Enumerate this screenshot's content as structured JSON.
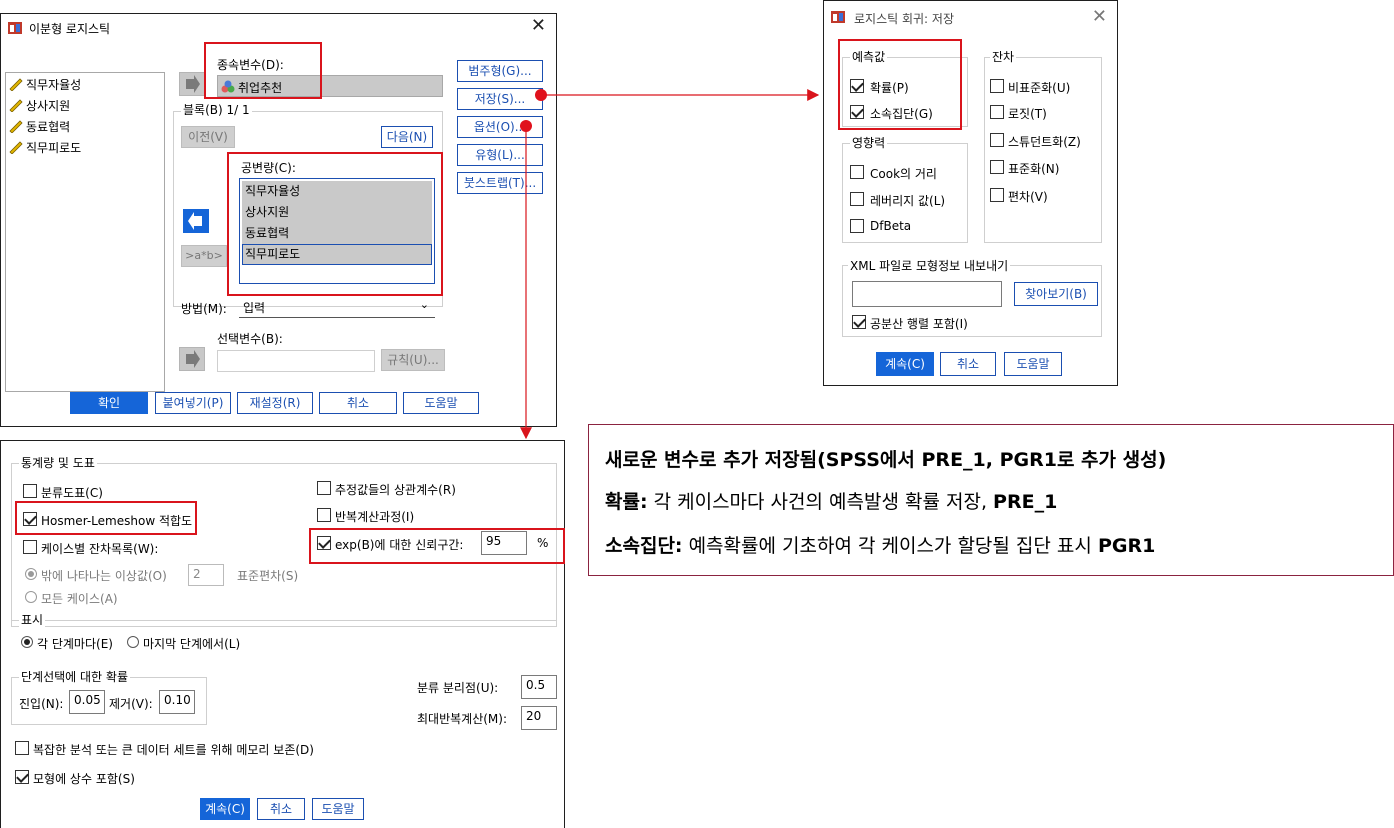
{
  "binary_dialog": {
    "title": "이분형 로지스틱",
    "variables": [
      "직무자율성",
      "상사지원",
      "동료협력",
      "직무피로도"
    ],
    "dependent_label": "종속변수(D):",
    "dependent_value": "취업추천",
    "block_label": "블록(B) 1/ 1",
    "prev_label": "이전(V)",
    "next_label": "다음(N)",
    "covariates_label": "공변량(C):",
    "covariates": [
      "직무자율성",
      "상사지원",
      "동료협력",
      "직무피로도"
    ],
    "interaction_label": ">a*b>",
    "method_label": "방법(M):",
    "method_value": "입력",
    "selection_label": "선택변수(B):",
    "rule_label": "규칙(U)...",
    "side_buttons": [
      "범주형(G)...",
      "저장(S)...",
      "옵션(O)...",
      "유형(L)...",
      "붓스트랩(T)..."
    ],
    "bottom_buttons": [
      "확인",
      "붙여넣기(P)",
      "재설정(R)",
      "취소",
      "도움말"
    ]
  },
  "save_dialog": {
    "title": "로지스틱 회귀: 저장",
    "predicted_group": "예측값",
    "predicted_items": [
      {
        "label": "확률(P)",
        "checked": true
      },
      {
        "label": "소속집단(G)",
        "checked": true
      }
    ],
    "influence_group": "영향력",
    "influence_items": [
      {
        "label": "Cook의 거리",
        "checked": false
      },
      {
        "label": "레버리지 값(L)",
        "checked": false
      },
      {
        "label": "DfBeta",
        "checked": false
      }
    ],
    "residual_group": "잔차",
    "residual_items": [
      {
        "label": "비표준화(U)",
        "checked": false
      },
      {
        "label": "로짓(T)",
        "checked": false
      },
      {
        "label": "스튜던트화(Z)",
        "checked": false
      },
      {
        "label": "표준화(N)",
        "checked": false
      },
      {
        "label": "편차(V)",
        "checked": false
      }
    ],
    "xml_group": "XML 파일로 모형정보 내보내기",
    "browse_label": "찾아보기(B)",
    "cov_matrix_label": "공분산 행렬 포함(I)",
    "cov_matrix_checked": true,
    "buttons": [
      "계속(C)",
      "취소",
      "도움말"
    ]
  },
  "options_dialog": {
    "stats_group": "통계량 및 도표",
    "classification_plot": "분류도표(C)",
    "hosmer": "Hosmer-Lemeshow 적합도",
    "casewise": "케이스별 잔차목록(W):",
    "outliers_label": "밖에 나타나는 이상값(O)",
    "outliers_value": "2",
    "sd_label": "표준편차(S)",
    "all_cases": "모든 케이스(A)",
    "correlations": "추정값들의 상관계수(R)",
    "iteration_history": "반복계산과정(I)",
    "ci_label": "exp(B)에 대한 신뢰구간:",
    "ci_value": "95",
    "ci_unit": "%",
    "display_group": "표시",
    "each_step": "각 단계마다(E)",
    "last_step": "마지막 단계에서(L)",
    "stepwise_group": "단계선택에 대한 확률",
    "entry_label": "진입(N):",
    "entry_value": "0.05",
    "removal_label": "제거(V):",
    "removal_value": "0.10",
    "cutoff_label": "분류 분리점(U):",
    "cutoff_value": "0.5",
    "max_iter_label": "최대반복계산(M):",
    "max_iter_value": "20",
    "memory_label": "복잡한 분석 또는 큰 데이터 세트를 위해 메모리 보존(D)",
    "constant_label": "모형에 상수 포함(S)",
    "buttons": [
      "계속(C)",
      "취소",
      "도움말"
    ]
  },
  "note": {
    "line1": "새로운 변수로 추가 저장됨(SPSS에서 PRE_1, PGR1로 추가 생성)",
    "line2_bold": "확률:",
    "line2_text": " 각 케이스마다 사건의 예측발생 확률 저장, ",
    "line2_code": "PRE_1",
    "line3_bold": "소속집단:",
    "line3_text": " 예측확률에 기초하여 각 케이스가 할당될 집단 표시 ",
    "line3_code": "PGR1"
  },
  "colors": {
    "accent": "#1565d8",
    "highlight": "#d9141c",
    "note_border": "#8b2340"
  }
}
